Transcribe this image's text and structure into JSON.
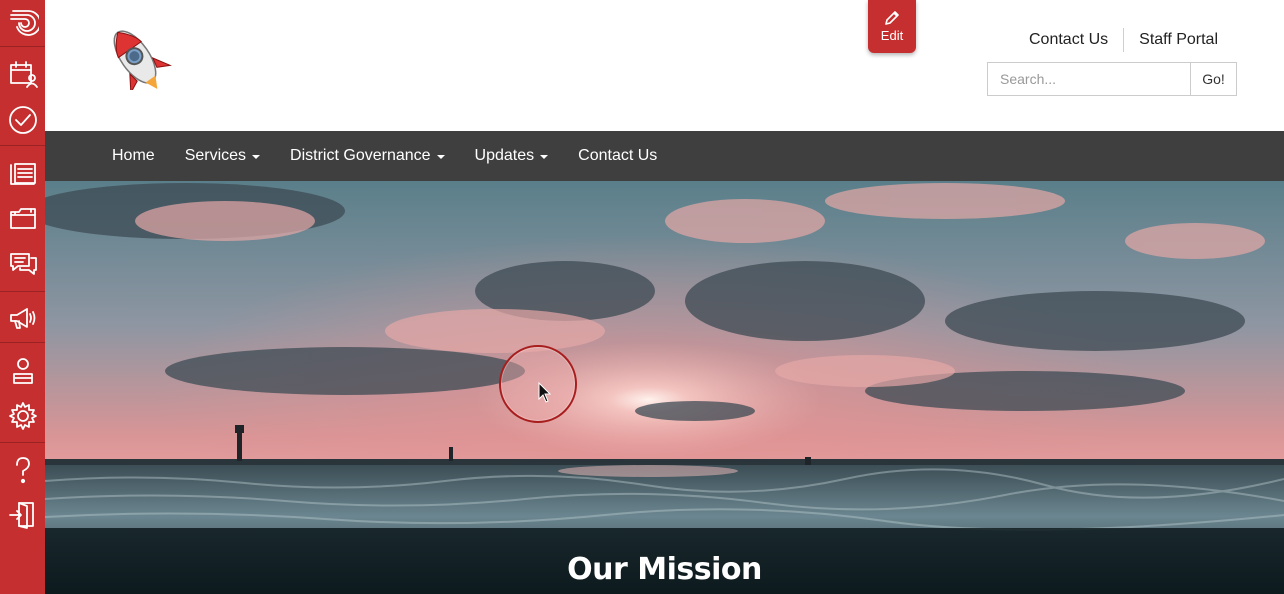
{
  "rail": {
    "items": [
      {
        "icon": "brand-swirl-icon"
      },
      {
        "icon": "calendar-user-icon"
      },
      {
        "icon": "check-circle-icon"
      },
      {
        "icon": "page-list-icon"
      },
      {
        "icon": "folder-icon"
      },
      {
        "icon": "chat-bubbles-icon"
      },
      {
        "icon": "megaphone-icon"
      },
      {
        "icon": "user-icon"
      },
      {
        "icon": "gear-icon"
      },
      {
        "icon": "help-icon"
      },
      {
        "icon": "logout-icon"
      }
    ],
    "color": "#c62f2f"
  },
  "header": {
    "logo_icon": "rocket-logo",
    "edit_label": "Edit",
    "util_links": {
      "contact": "Contact Us",
      "staff": "Staff Portal"
    },
    "search": {
      "placeholder": "Search...",
      "button": "Go!"
    }
  },
  "nav": {
    "items": [
      {
        "label": "Home",
        "dropdown": false
      },
      {
        "label": "Services",
        "dropdown": true
      },
      {
        "label": "District Governance",
        "dropdown": true
      },
      {
        "label": "Updates",
        "dropdown": true
      },
      {
        "label": "Contact Us",
        "dropdown": false
      }
    ],
    "background": "#3f3f3f"
  },
  "hero": {
    "image": "sunset over the sea",
    "mission_title": "Our Mission"
  }
}
